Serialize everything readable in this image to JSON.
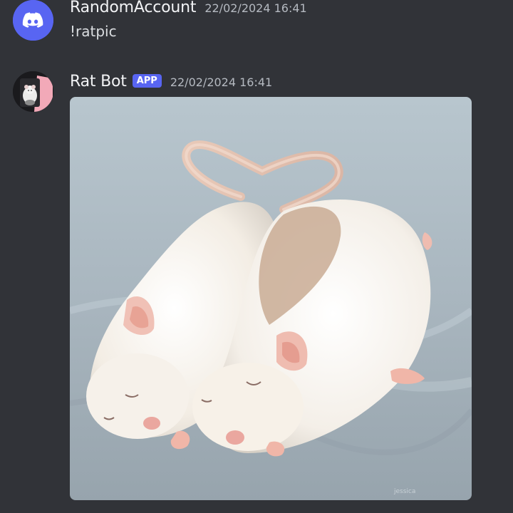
{
  "messages": [
    {
      "username": "RandomAccount",
      "timestamp": "22/02/2024 16:41",
      "content": "!ratpic",
      "avatar_icon": "discord-logo-icon",
      "avatar_color": "#5865F2"
    },
    {
      "username": "Rat Bot",
      "badge": "APP",
      "timestamp": "22/02/2024 16:41",
      "avatar_icon": "rat-photo-avatar",
      "attachment": {
        "type": "image",
        "subject": "two white rats sleeping side by side with tails forming a heart"
      }
    }
  ],
  "colors": {
    "background": "#313338",
    "username": "#f2f3f5",
    "timestamp": "#b5bac1",
    "text": "#dbdee1",
    "badge": "#5865F2"
  }
}
